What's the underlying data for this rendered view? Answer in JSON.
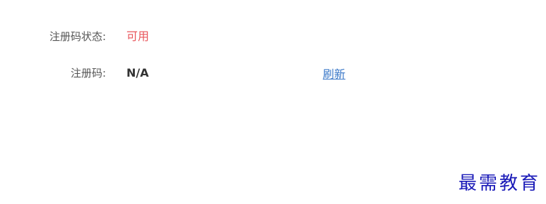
{
  "registration": {
    "status_label": "注册码状态:",
    "status_value": "可用",
    "code_label": "注册码:",
    "code_value": "N/A",
    "refresh_label": "刷新"
  },
  "watermark": {
    "text": "最需教育"
  },
  "colors": {
    "status_available": "#e8545a",
    "link": "#3a78c8",
    "watermark": "#1a1ab8"
  }
}
